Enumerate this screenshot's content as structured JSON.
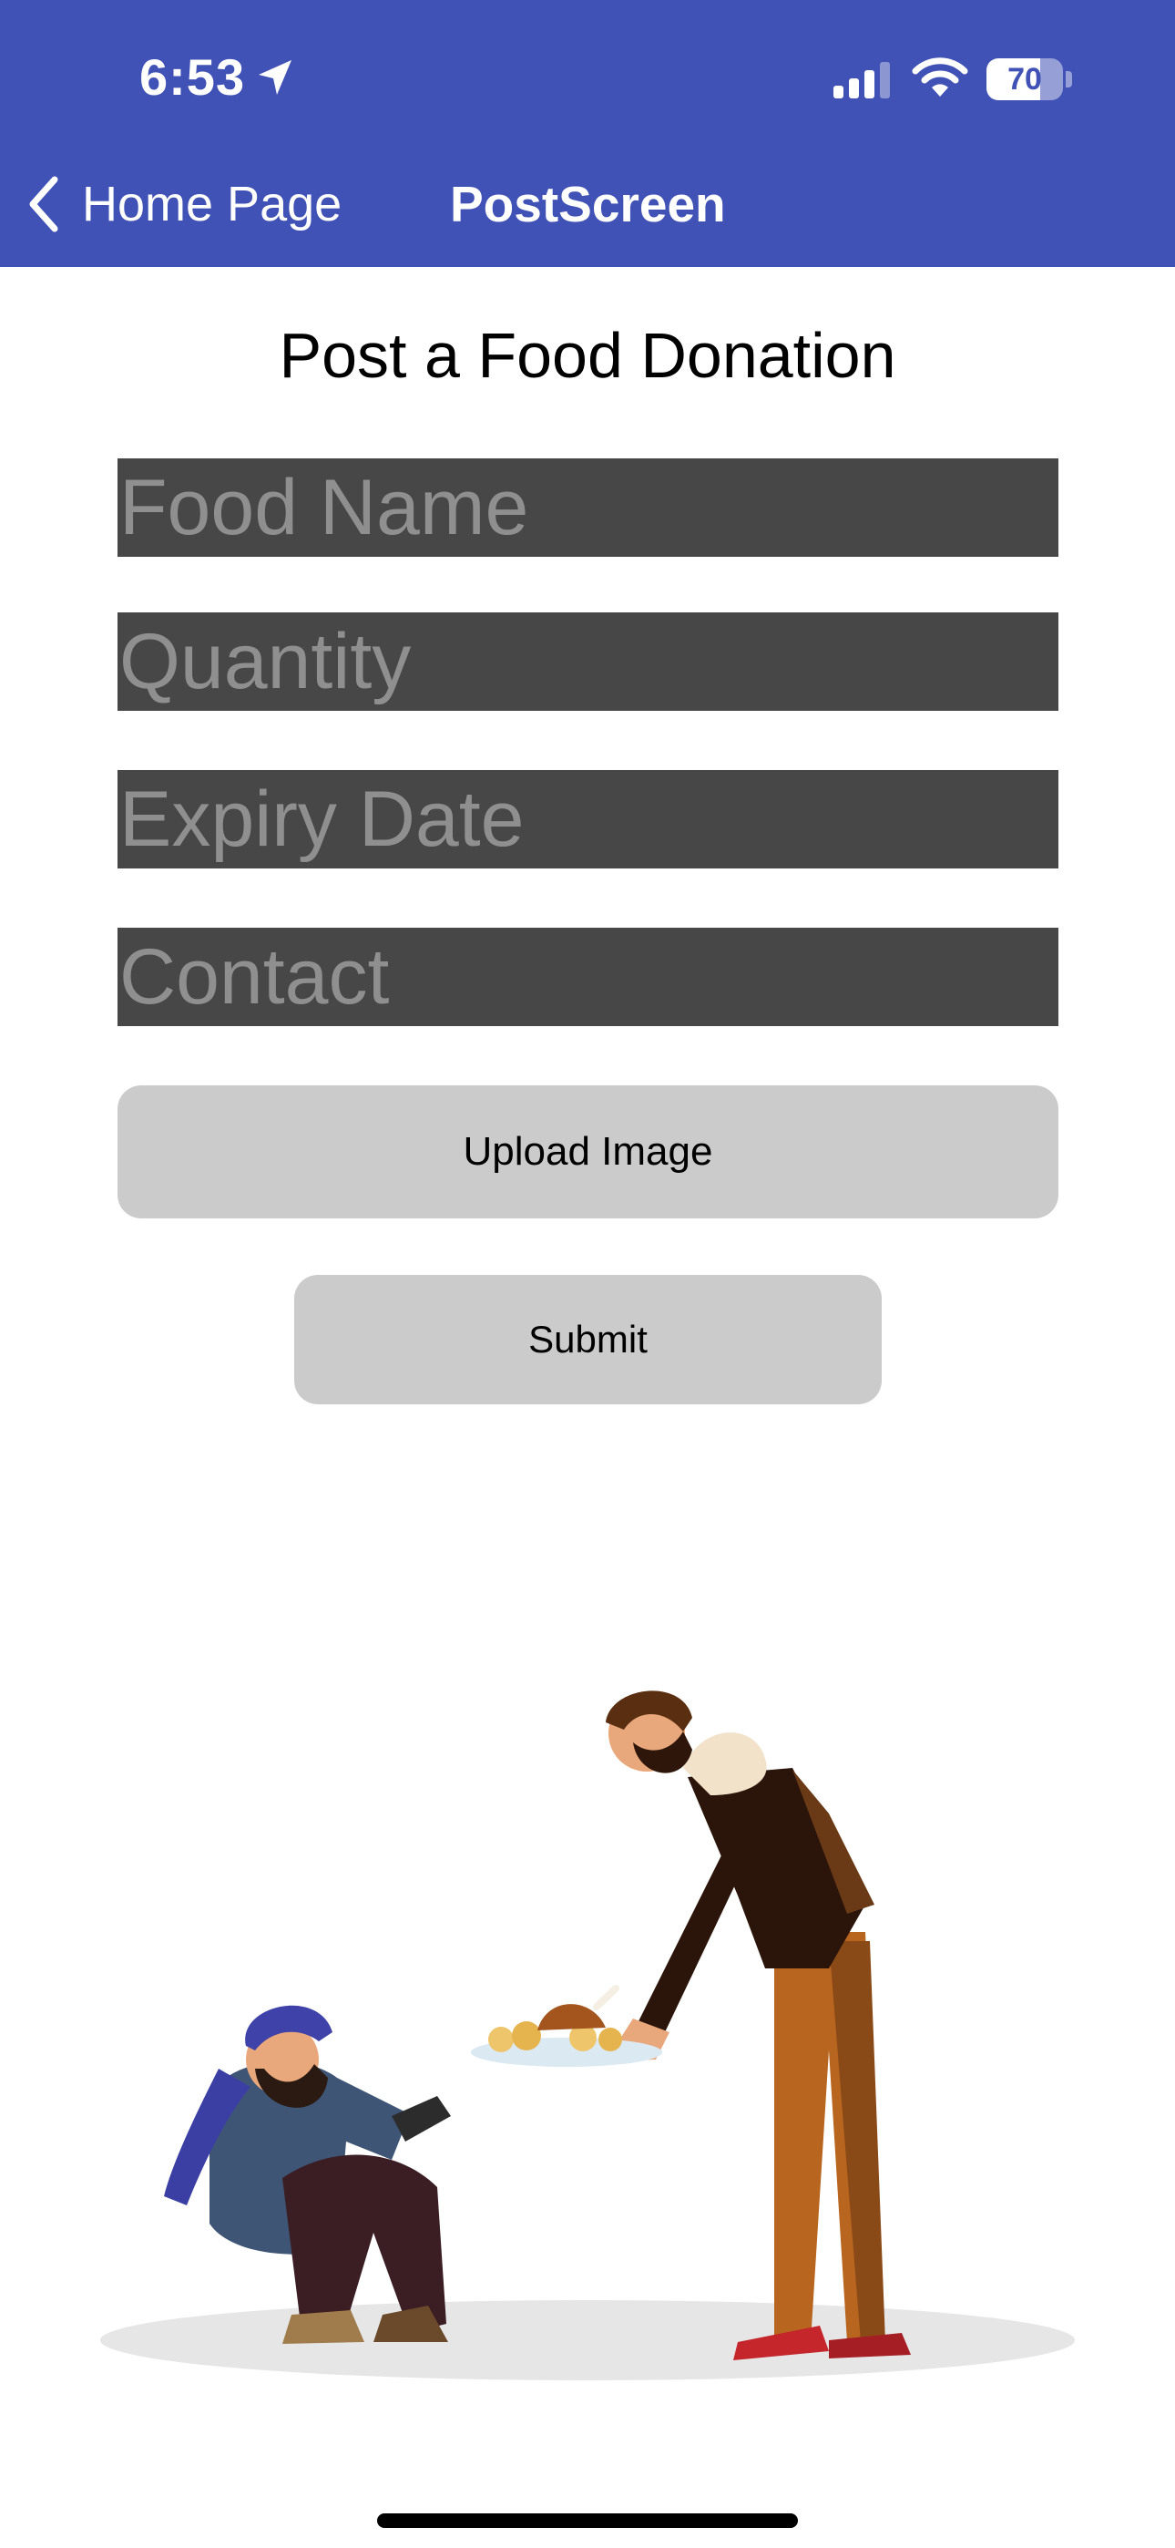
{
  "status_bar": {
    "time": "6:53",
    "battery": "70",
    "battery_level_percent": 70,
    "icons": [
      "location-arrow-icon",
      "cellular-signal-icon",
      "wifi-icon",
      "battery-icon"
    ]
  },
  "nav": {
    "back_label": "Home Page",
    "title": "PostScreen",
    "back_icon": "chevron-left-icon"
  },
  "form": {
    "heading": "Post a Food Donation",
    "food_name_placeholder": "Food Name",
    "quantity_placeholder": "Quantity",
    "expiry_placeholder": "Expiry Date",
    "contact_placeholder": "Contact",
    "upload_label": "Upload Image",
    "submit_label": "Submit"
  },
  "illustration": {
    "icon": "food-donation-illustration"
  },
  "colors": {
    "header_bg": "#4052b5",
    "field_bg": "#474747",
    "placeholder": "#8f8f8f",
    "button_bg": "#cbcbcb"
  }
}
